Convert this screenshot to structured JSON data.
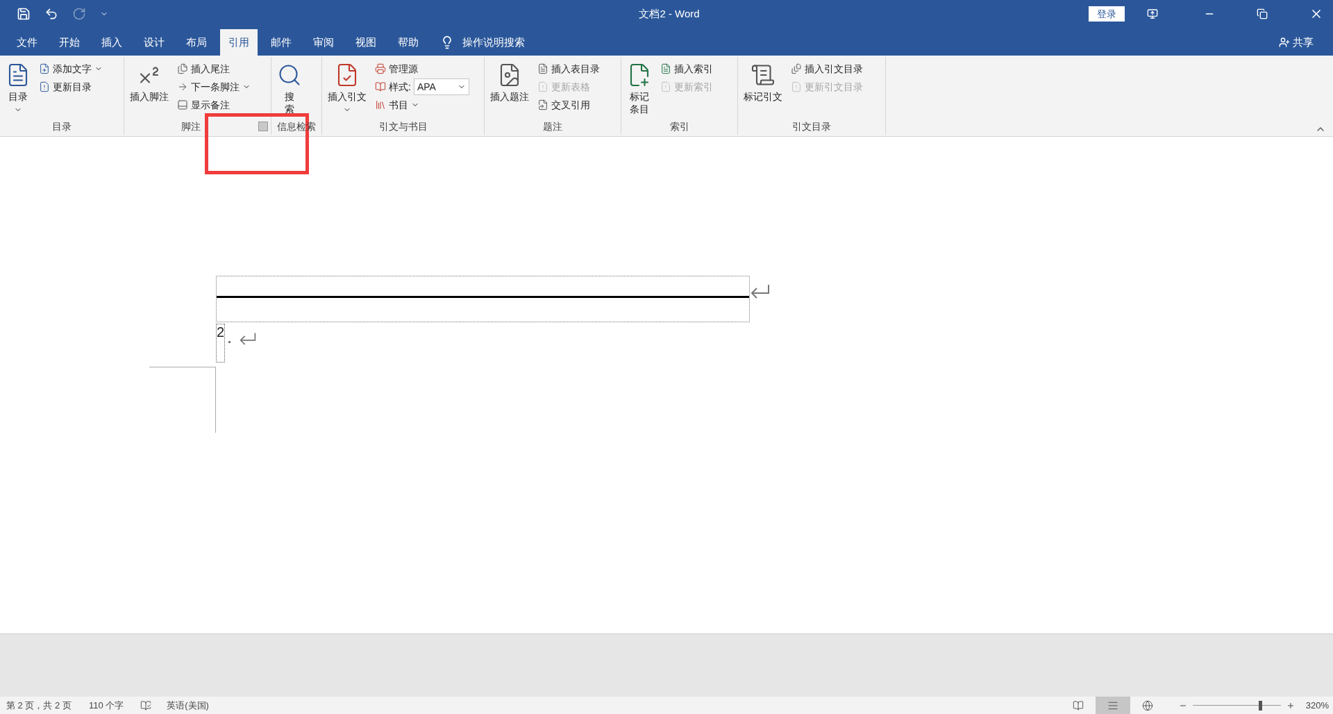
{
  "title_bar": {
    "title": "文档2 - Word",
    "login": "登录"
  },
  "menu_tabs": [
    {
      "label": "文件",
      "selected": false
    },
    {
      "label": "开始",
      "selected": false
    },
    {
      "label": "插入",
      "selected": false
    },
    {
      "label": "设计",
      "selected": false
    },
    {
      "label": "布局",
      "selected": false
    },
    {
      "label": "引用",
      "selected": true
    },
    {
      "label": "邮件",
      "selected": false
    },
    {
      "label": "审阅",
      "selected": false
    },
    {
      "label": "视图",
      "selected": false
    },
    {
      "label": "帮助",
      "selected": false
    }
  ],
  "tell_me": "操作说明搜索",
  "share": "共享",
  "ribbon": [
    {
      "label": "目录",
      "items": [
        {
          "kind": "large",
          "label": "目录",
          "dropdown": true,
          "disabled": false
        },
        {
          "kind": "small",
          "label": "添加文字",
          "dropdown": true,
          "disabled": false
        },
        {
          "kind": "small",
          "label": "更新目录",
          "dropdown": false,
          "disabled": false
        }
      ]
    },
    {
      "label": "脚注",
      "items": [
        {
          "kind": "large",
          "label": "插入脚注",
          "dropdown": false,
          "disabled": false
        },
        {
          "kind": "small",
          "label": "插入尾注",
          "dropdown": false,
          "disabled": false
        },
        {
          "kind": "small",
          "label": "下一条脚注",
          "dropdown": true,
          "disabled": false
        },
        {
          "kind": "small",
          "label": "显示备注",
          "dropdown": false,
          "disabled": false
        }
      ]
    },
    {
      "label": "信息检索",
      "items": [
        {
          "kind": "large",
          "label": "搜索",
          "dropdown": false,
          "disabled": false
        }
      ]
    },
    {
      "label": "引文与书目",
      "items": [
        {
          "kind": "large",
          "label": "插入引文",
          "dropdown": true,
          "disabled": false
        },
        {
          "kind": "small",
          "label": "管理源",
          "dropdown": false,
          "disabled": false
        },
        {
          "kind": "select",
          "label": "样式:",
          "value": "APA",
          "dropdown": true,
          "disabled": false
        },
        {
          "kind": "small",
          "label": "书目",
          "dropdown": true,
          "disabled": false
        }
      ]
    },
    {
      "label": "题注",
      "items": [
        {
          "kind": "large",
          "label": "插入题注",
          "dropdown": false,
          "disabled": false
        },
        {
          "kind": "small",
          "label": "插入表目录",
          "dropdown": false,
          "disabled": false
        },
        {
          "kind": "small",
          "label": "更新表格",
          "dropdown": false,
          "disabled": true
        },
        {
          "kind": "small",
          "label": "交叉引用",
          "dropdown": false,
          "disabled": false
        }
      ]
    },
    {
      "label": "索引",
      "items": [
        {
          "kind": "large",
          "label": "标记条目",
          "dropdown": false,
          "disabled": false
        },
        {
          "kind": "small",
          "label": "插入索引",
          "dropdown": false,
          "disabled": false
        },
        {
          "kind": "small",
          "label": "更新索引",
          "dropdown": false,
          "disabled": true
        }
      ]
    },
    {
      "label": "引文目录",
      "items": [
        {
          "kind": "large",
          "label": "标记引文",
          "dropdown": false,
          "disabled": false
        },
        {
          "kind": "small",
          "label": "插入引文目录",
          "dropdown": false,
          "disabled": false
        },
        {
          "kind": "small",
          "label": "更新引文目录",
          "dropdown": false,
          "disabled": true
        }
      ]
    }
  ],
  "document": {
    "footnote_number": "2"
  },
  "status_bar": {
    "page": "第 2 页，共 2 页",
    "words": "110 个字",
    "language": "英语(美国)",
    "views": [
      {
        "selected": false
      },
      {
        "selected": true
      },
      {
        "selected": false
      }
    ],
    "zoom": {
      "level": 0.77,
      "reading": "320%"
    }
  }
}
